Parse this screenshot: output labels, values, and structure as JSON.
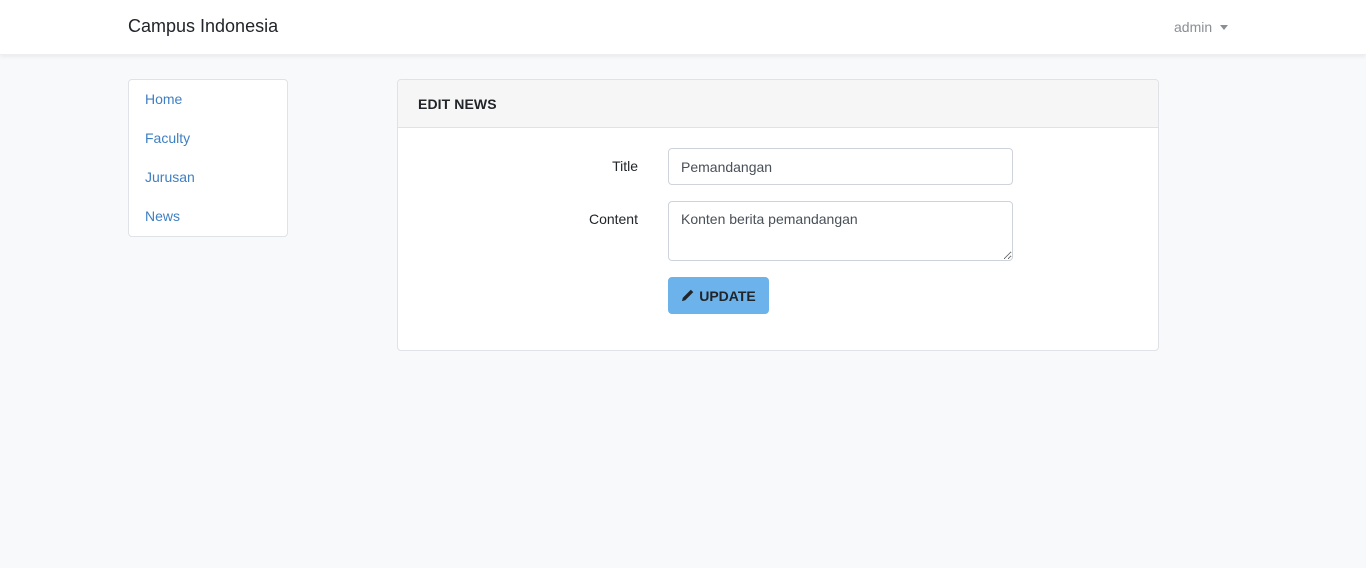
{
  "navbar": {
    "brand": "Campus Indonesia",
    "user": "admin"
  },
  "sidebar": {
    "items": [
      {
        "label": "Home"
      },
      {
        "label": "Faculty"
      },
      {
        "label": "Jurusan"
      },
      {
        "label": "News"
      }
    ]
  },
  "card": {
    "title": "EDIT NEWS",
    "form": {
      "title_label": "Title",
      "title_value": "Pemandangan",
      "content_label": "Content",
      "content_value": "Konten berita pemandangan",
      "submit_label": "UPDATE",
      "submit_icon": "pencil-icon"
    }
  },
  "colors": {
    "link": "#3f7fc3",
    "button": "#6cb2eb",
    "background": "#f8f9fb"
  }
}
